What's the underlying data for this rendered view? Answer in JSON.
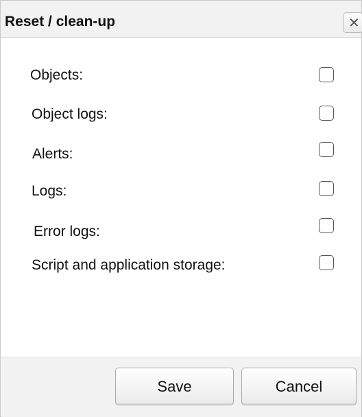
{
  "dialog": {
    "title": "Reset / clean-up",
    "close_icon": "close-icon"
  },
  "options": [
    {
      "label": "Objects:",
      "checked": false
    },
    {
      "label": "Object logs:",
      "checked": false
    },
    {
      "label": "Alerts:",
      "checked": false
    },
    {
      "label": "Logs:",
      "checked": false
    },
    {
      "label": "Error logs:",
      "checked": false
    },
    {
      "label": "Script and application storage:",
      "checked": false
    }
  ],
  "buttons": {
    "save_label": "Save",
    "cancel_label": "Cancel"
  }
}
